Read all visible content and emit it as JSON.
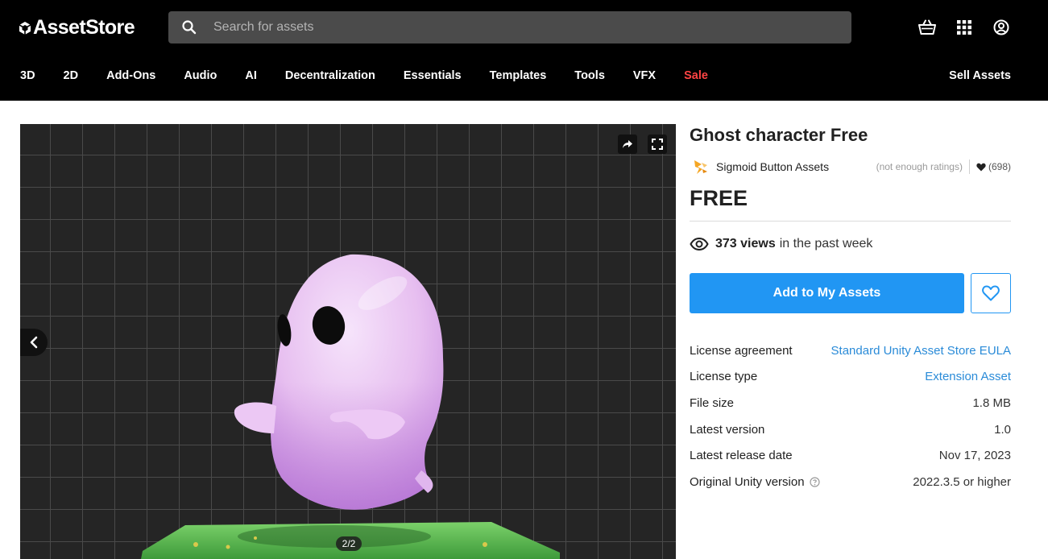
{
  "header": {
    "logo_text": "AssetStore",
    "search_placeholder": "Search for assets",
    "icons": [
      "cart-icon",
      "apps-grid-icon",
      "account-icon"
    ]
  },
  "nav": {
    "items": [
      "3D",
      "2D",
      "Add-Ons",
      "Audio",
      "AI",
      "Decentralization",
      "Essentials",
      "Templates",
      "Tools",
      "VFX",
      "Sale"
    ],
    "sell_label": "Sell Assets",
    "sale_color": "#ff4444"
  },
  "viewer": {
    "counter": "2/2",
    "icons": [
      "share-icon",
      "fullscreen-icon",
      "chevron-left-icon"
    ]
  },
  "product": {
    "title": "Ghost character Free",
    "publisher": "Sigmoid Button Assets",
    "ratings": "(not enough ratings)",
    "favorites": "(698)",
    "price": "FREE",
    "views_count": "373 views",
    "views_suffix": "in the past week",
    "add_button": "Add to My Assets",
    "accent_color": "#2196f3"
  },
  "meta": {
    "rows": [
      {
        "label": "License agreement",
        "value": "Standard Unity Asset Store EULA"
      },
      {
        "label": "License type",
        "value": "Extension Asset"
      },
      {
        "label": "File size",
        "value": "1.8 MB"
      },
      {
        "label": "Latest version",
        "value": "1.0"
      },
      {
        "label": "Latest release date",
        "value": "Nov 17, 2023"
      },
      {
        "label": "Original Unity version",
        "value": "2022.3.5 or higher"
      }
    ]
  }
}
